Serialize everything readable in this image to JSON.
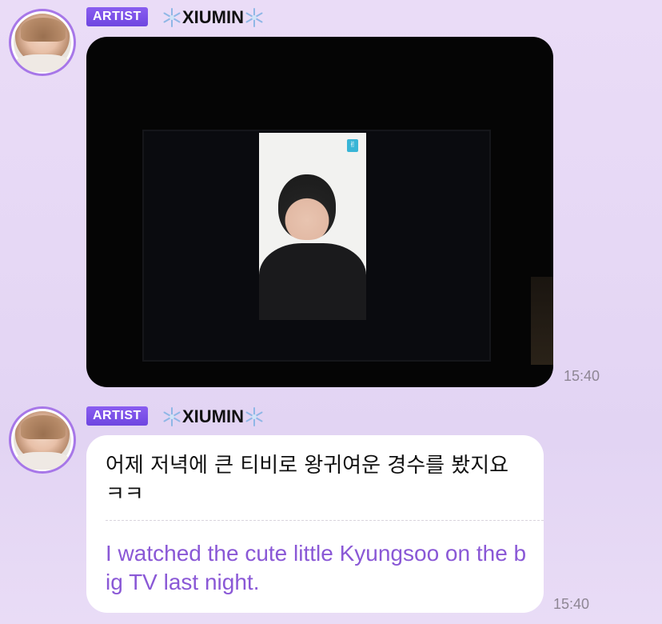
{
  "messages": [
    {
      "badge": "ARTIST",
      "sender": "XIUMIN",
      "sender_icon": "snowflake-icon",
      "type": "image",
      "time": "15:40"
    },
    {
      "badge": "ARTIST",
      "sender": "XIUMIN",
      "sender_icon": "snowflake-icon",
      "type": "text",
      "text_korean": "어제 저녁에 큰 티비로 왕귀여운 경수를 봤지요 ㅋㅋ",
      "text_translation": "I watched the cute little Kyungsoo on the big TV last night.",
      "time": "15:40"
    }
  ],
  "colors": {
    "badge": "#7b52e8",
    "avatar_ring": "#a777e8",
    "translation_text": "#8a58d6",
    "timestamp": "#8e8694"
  }
}
